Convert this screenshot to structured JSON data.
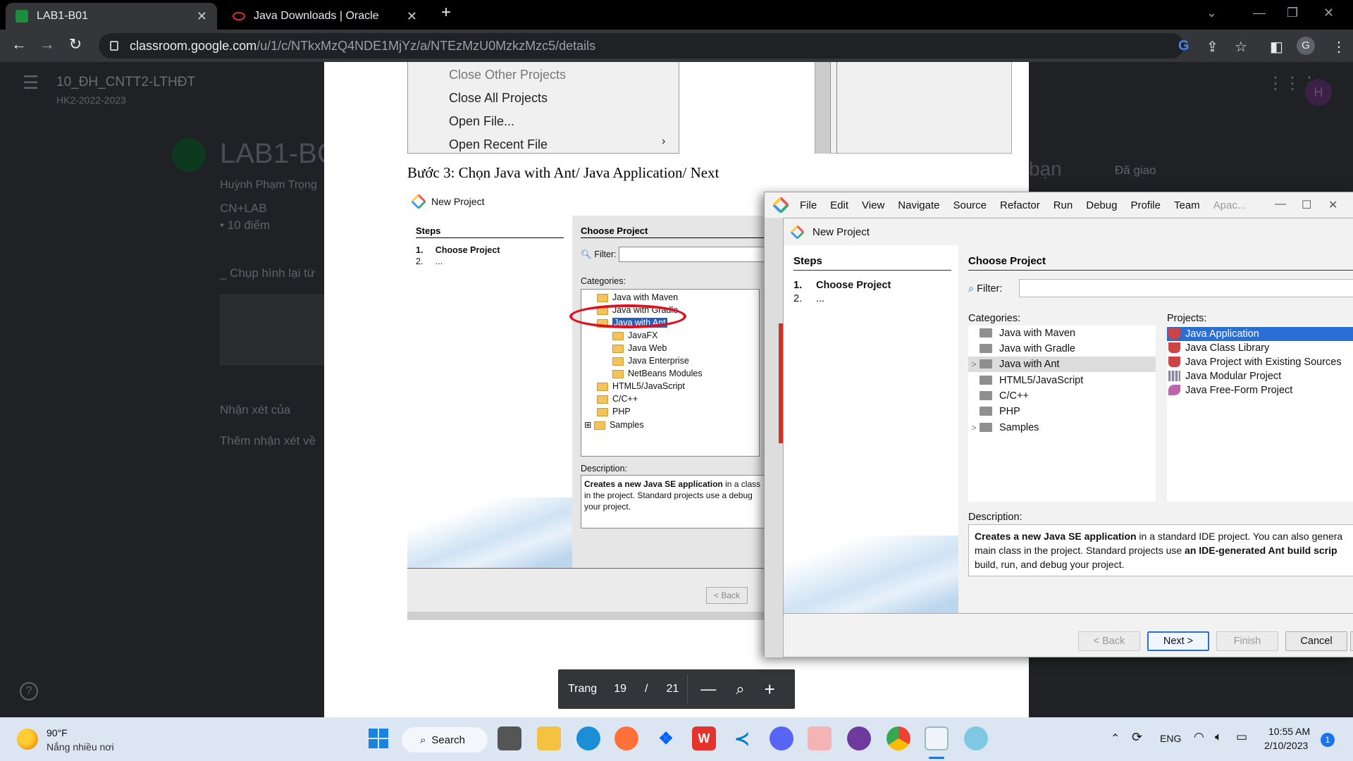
{
  "browser": {
    "tabs": [
      {
        "title": "LAB1-B01",
        "active": true
      },
      {
        "title": "Java Downloads | Oracle",
        "active": false
      }
    ],
    "url_host": "classroom.google.com",
    "url_path": "/u/1/c/NTkxMzQ4NDE1MjYz/a/NTEzMzU0MzkzMzc5/details",
    "profile_initial": "G"
  },
  "classroom": {
    "class_name": "10_ĐH_CNTT2-LTHĐT",
    "term": "HK2-2022-2023",
    "assignment_title": "LAB1-BC",
    "teacher": "Huỳnh Phạm Trọng",
    "topic": "CN+LAB",
    "points": "• 10 điểm",
    "instruction": "_ Chụp hình lại từ",
    "comments_label": "Nhận xét của",
    "add_comment": "Thêm nhận xét về",
    "your_work": "bạn",
    "status": "Đã giao",
    "avatar_initial": "H"
  },
  "pdf": {
    "menu_items": [
      "Close Other Projects",
      "Close All Projects",
      "Open File...",
      "Open Recent File"
    ],
    "step_text": "Bước 3: Chọn Java with Ant/ Java Application/ Next",
    "mini_dialog": {
      "title": "New Project",
      "steps_header": "Steps",
      "step1": "Choose Project",
      "step2": "...",
      "choose_header": "Choose Project",
      "filter_label": "Filter:",
      "categories_label": "Categories:",
      "categories": [
        "Java with Maven",
        "Java with Gradle",
        "Java with Ant",
        "JavaFX",
        "Java Web",
        "Java Enterprise",
        "NetBeans Modules",
        "HTML5/JavaScript",
        "C/C++",
        "PHP",
        "Samples"
      ],
      "description_label": "Description:",
      "description_bold": "Creates a new Java SE application",
      "description_rest": " in a class in the project. Standard projects use a debug your project.",
      "back_label": "< Back"
    },
    "page_label": "Trang",
    "current_page": "19",
    "page_sep": "/",
    "total_pages": "21"
  },
  "netbeans": {
    "menu": [
      "File",
      "Edit",
      "View",
      "Navigate",
      "Source",
      "Refactor",
      "Run",
      "Debug",
      "Profile",
      "Team",
      "Apac..."
    ],
    "dialog": {
      "title": "New Project",
      "steps_header": "Steps",
      "step1_num": "1.",
      "step1": "Choose Project",
      "step2_num": "2.",
      "step2": "...",
      "choose_header": "Choose Project",
      "filter_label": "Filter:",
      "filter_value": "",
      "categories_label": "Categories:",
      "projects_label": "Projects:",
      "categories": [
        "Java with Maven",
        "Java with Gradle",
        "Java with Ant",
        "HTML5/JavaScript",
        "C/C++",
        "PHP",
        "Samples"
      ],
      "selected_category": "Java with Ant",
      "projects": [
        "Java Application",
        "Java Class Library",
        "Java Project with Existing Sources",
        "Java Modular Project",
        "Java Free-Form Project"
      ],
      "selected_project": "Java Application",
      "description_label": "Description:",
      "desc_line1_bold": "Creates a new Java SE application",
      "desc_line1_rest": " in a standard IDE project. You can also genera",
      "desc_line2_start": "main class in the project. Standard projects use ",
      "desc_line2_bold": "an IDE-generated Ant build scrip",
      "desc_line3": "build, run, and debug your project.",
      "buttons": {
        "back": "< Back",
        "next": "Next >",
        "finish": "Finish",
        "cancel": "Cancel"
      }
    }
  },
  "taskbar": {
    "weather_temp": "90°F",
    "weather_desc": "Nắng nhiều nơi",
    "search_label": "Search",
    "lang": "ENG",
    "time": "10:55 AM",
    "date": "2/10/2023",
    "notification_count": "1"
  }
}
